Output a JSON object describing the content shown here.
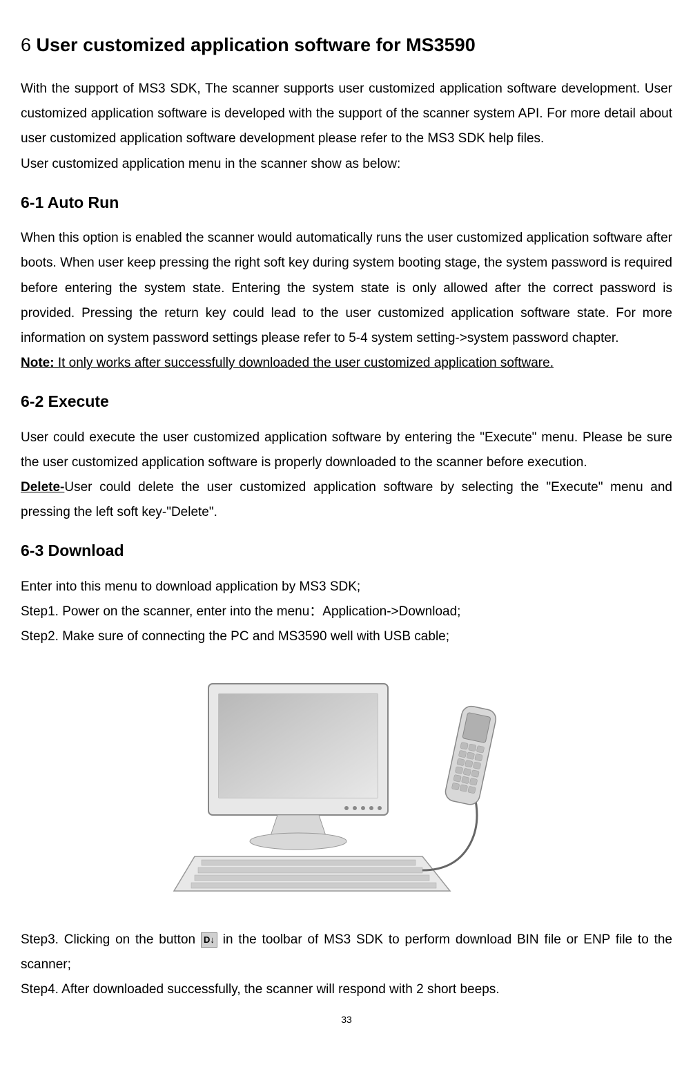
{
  "heading1": {
    "num": "6 ",
    "text": "User customized application software for MS3590"
  },
  "intro": {
    "p1": "With the support of MS3 SDK, The scanner supports user customized application software development. User customized application software is developed with the support of the scanner system API. For more detail about user customized application software development please refer to the MS3 SDK help files.",
    "p2": "User customized application menu in the scanner show as below:"
  },
  "section61": {
    "title": "6-1 Auto Run",
    "p1": "When this option is enabled the scanner would automatically runs the user customized application software after boots. When user keep pressing the right soft key during system booting stage, the system password is required before entering the system state. Entering the system state is only allowed after the correct password is provided. Pressing the return key could lead to the user customized application software state. For more information on system password settings please refer to 5-4 system setting->system password chapter.",
    "note_label": "Note:",
    "note_text": " It only works after successfully downloaded the user customized application software."
  },
  "section62": {
    "title": "6-2 Execute",
    "p1": "User could execute the user customized application software by entering the \"Execute\" menu. Please be sure the user customized application software is properly downloaded to the scanner before execution.",
    "delete_label": "Delete-",
    "delete_text": "User could delete the user customized application software by selecting the \"Execute\" menu and pressing the left soft key-\"Delete\"."
  },
  "section63": {
    "title": "6-3 Download",
    "intro": "Enter into this menu to download application by MS3 SDK;",
    "step1": "Step1. Power on the scanner, enter into the menu：Application->Download;",
    "step2": "Step2. Make sure of connecting the PC and MS3590 well with USB cable;",
    "step3_a": "Step3. Clicking on the button ",
    "step3_b": " in the toolbar of MS3 SDK to perform download BIN file or ENP file to the scanner;",
    "step4": "Step4. After downloaded successfully, the scanner will respond with 2 short beeps.",
    "icon_label": "D↓"
  },
  "page_number": "33"
}
